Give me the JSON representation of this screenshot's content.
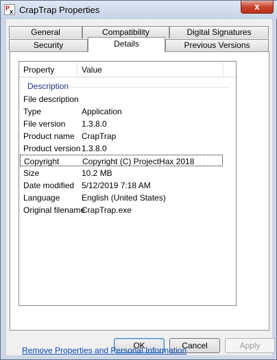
{
  "window": {
    "title": "CrapTrap Properties",
    "close_glyph": "x"
  },
  "tabs_row1": [
    {
      "label": "General"
    },
    {
      "label": "Compatibility"
    },
    {
      "label": "Digital Signatures"
    }
  ],
  "tabs_row2": [
    {
      "label": "Security"
    },
    {
      "label": "Details"
    },
    {
      "label": "Previous Versions"
    }
  ],
  "list": {
    "headers": {
      "property": "Property",
      "value": "Value"
    },
    "group": "Description",
    "rows": [
      {
        "property": "File description",
        "value": ""
      },
      {
        "property": "Type",
        "value": "Application"
      },
      {
        "property": "File version",
        "value": "1.3.8.0"
      },
      {
        "property": "Product name",
        "value": "CrapTrap"
      },
      {
        "property": "Product version",
        "value": "1.3.8.0"
      },
      {
        "property": "Copyright",
        "value": "Copyright (C) ProjectHax 2018"
      },
      {
        "property": "Size",
        "value": "10.2 MB"
      },
      {
        "property": "Date modified",
        "value": "5/12/2019 7:18 AM"
      },
      {
        "property": "Language",
        "value": "English (United States)"
      },
      {
        "property": "Original filename",
        "value": "CrapTrap.exe"
      }
    ]
  },
  "remove_link": "Remove Properties and Personal Information",
  "buttons": {
    "ok": "OK",
    "cancel": "Cancel",
    "apply": "Apply"
  },
  "colors": {
    "group_label": "#1e3287",
    "link": "#0645ad",
    "close": "#c7432d"
  }
}
